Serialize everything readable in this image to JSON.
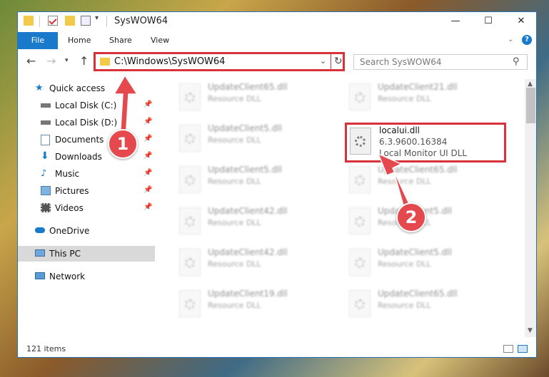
{
  "window": {
    "title": "SysWOW64",
    "min": "—",
    "max": "☐",
    "close": "✕"
  },
  "ribbon": {
    "tabs": [
      "File",
      "Home",
      "Share",
      "View"
    ],
    "help": "?"
  },
  "nav": {
    "back": "←",
    "forward": "→",
    "recent": "▾",
    "up": "↑",
    "address": "C:\\Windows\\SysWOW64",
    "search_placeholder": "Search SysWOW64"
  },
  "sidebar": {
    "items": [
      {
        "label": "Quick access",
        "icon": "star-icon",
        "pinned": false
      },
      {
        "label": "Local Disk (C:)",
        "icon": "drive-icon",
        "pinned": true
      },
      {
        "label": "Local Disk (D:)",
        "icon": "drive-icon",
        "pinned": true
      },
      {
        "label": "Documents",
        "icon": "documents-icon",
        "pinned": true
      },
      {
        "label": "Downloads",
        "icon": "download-icon",
        "pinned": true
      },
      {
        "label": "Music",
        "icon": "music-icon",
        "pinned": true
      },
      {
        "label": "Pictures",
        "icon": "pictures-icon",
        "pinned": true
      },
      {
        "label": "Videos",
        "icon": "videos-icon",
        "pinned": true
      },
      {
        "label": "OneDrive",
        "icon": "cloud-icon",
        "pinned": false
      },
      {
        "label": "This PC",
        "icon": "computer-icon",
        "pinned": false
      },
      {
        "label": "Network",
        "icon": "network-icon",
        "pinned": false
      }
    ]
  },
  "files": [
    {
      "name": "UpdateClient65.dll",
      "desc": "Resource DLL"
    },
    {
      "name": "UpdateClient21.dll",
      "desc": "Resource DLL"
    },
    {
      "name": "UpdateClient5.dll",
      "desc": "Resource DLL"
    },
    {
      "name": "UpdateClient5.dll",
      "desc": "Resource DLL"
    },
    {
      "name": "UpdateClient65.dll",
      "desc": "Resource DLL"
    },
    {
      "name": "UpdateClient42.dll",
      "desc": "Resource DLL"
    },
    {
      "name": "UpdateClient5.dll",
      "desc": "Resource DLL"
    },
    {
      "name": "UpdateClient42.dll",
      "desc": "Resource DLL"
    },
    {
      "name": "UpdateClient5.dll",
      "desc": "Resource DLL"
    },
    {
      "name": "UpdateClient19.dll",
      "desc": "Resource DLL"
    },
    {
      "name": "UpdateClient65.dll",
      "desc": "Resource DLL"
    }
  ],
  "highlighted_file": {
    "name": "localui.dll",
    "version": "6.3.9600.16384",
    "desc": "Local Monitor UI DLL"
  },
  "status": {
    "items_count": "121 items"
  },
  "annotations": {
    "step1": "1",
    "step2": "2",
    "color": "#e5484d"
  }
}
